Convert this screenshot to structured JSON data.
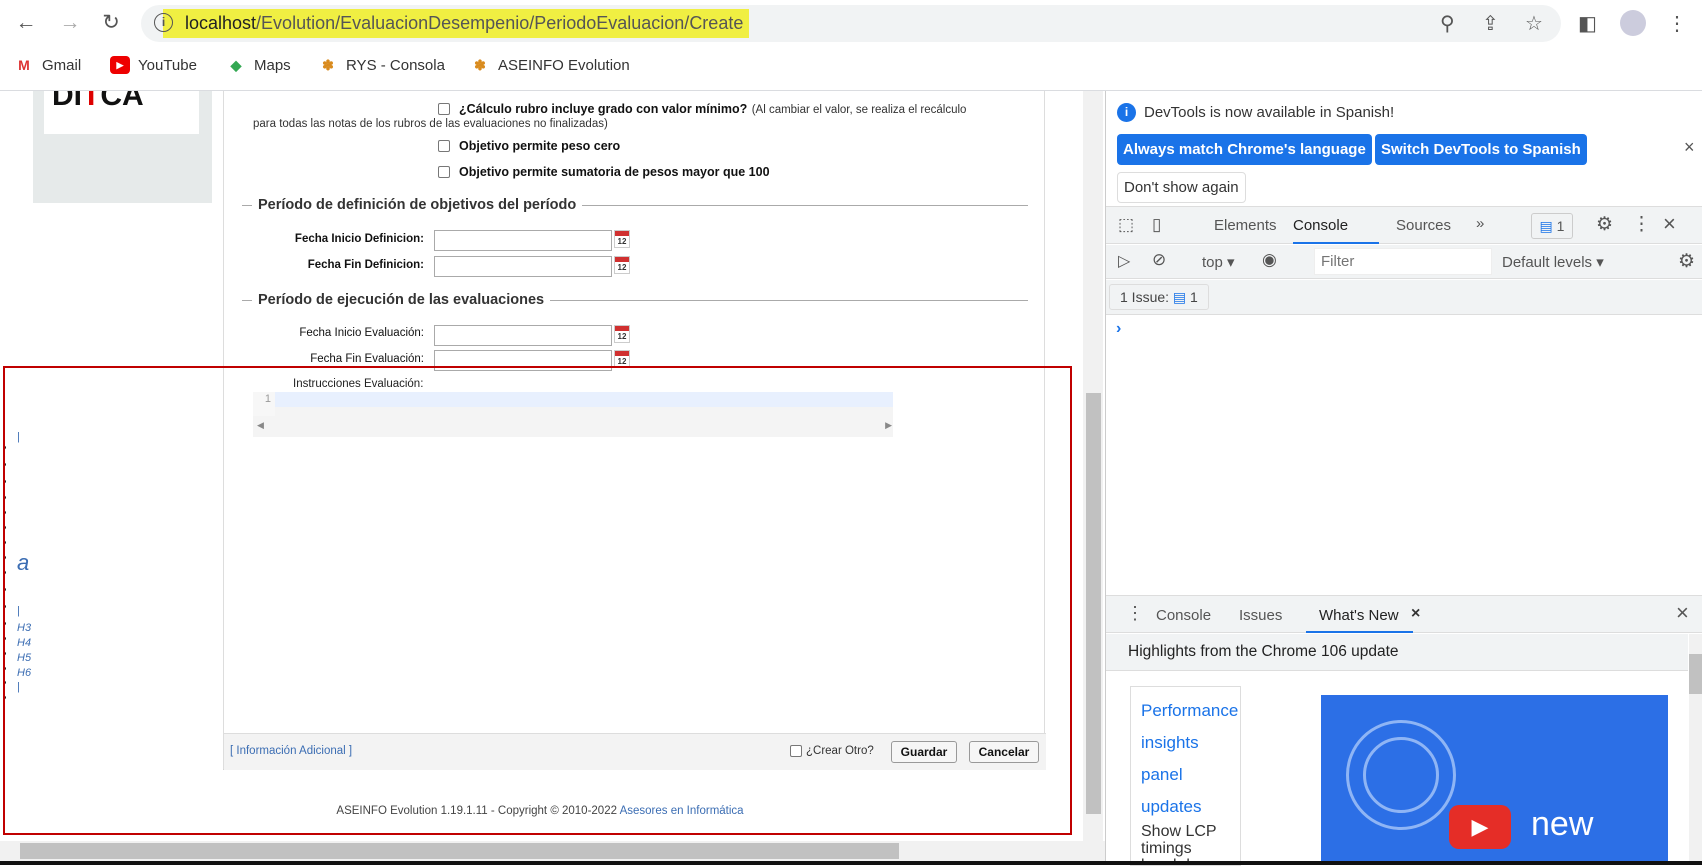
{
  "browser": {
    "url_host": "localhost",
    "url_path": "/Evolution/EvaluacionDesempenio/PeriodoEvaluacion/Create",
    "bookmarks": [
      {
        "label": "Gmail",
        "icon": "gmail-icon"
      },
      {
        "label": "YouTube",
        "icon": "youtube-icon"
      },
      {
        "label": "Maps",
        "icon": "maps-icon"
      },
      {
        "label": "RYS - Consola",
        "icon": "aseinfo-icon"
      },
      {
        "label": "ASEINFO Evolution",
        "icon": "aseinfo-icon"
      }
    ]
  },
  "logo": {
    "text": "DITCA"
  },
  "form": {
    "checks": [
      {
        "label": "¿Cálculo rubro incluye grado con valor mínimo?",
        "note": "(Al cambiar el valor, se realiza el recálculo",
        "note2": "para todas las notas de los rubros de las evaluaciones no finalizadas)"
      },
      {
        "label": "Objetivo permite peso cero"
      },
      {
        "label": "Objetivo permite sumatoria de pesos mayor que 100"
      }
    ],
    "section1": "Período de definición de objetivos del período",
    "fecha_inicio_def": "Fecha Inicio Definicion:",
    "fecha_fin_def": "Fecha Fin Definicion:",
    "section2": "Período de ejecución de las evaluaciones",
    "fecha_inicio_eval": "Fecha Inicio Evaluación:",
    "fecha_fin_eval": "Fecha Fin Evaluación:",
    "instrucciones": "Instrucciones Evaluación:",
    "line_number": "1",
    "calendar_day": "12",
    "info_adicional": "[ Información Adicional ]",
    "crear_otro": "¿Crear Otro?",
    "guardar": "Guardar",
    "cancelar": "Cancelar"
  },
  "stray": {
    "a": "a",
    "pipe": "|",
    "h3": "H3",
    "h4": "H4",
    "h5": "H5",
    "h6": "H6"
  },
  "footer": {
    "text": "ASEINFO Evolution 1.19.1.11 - Copyright © 2010-2022 ",
    "link": "Asesores en Informática"
  },
  "devtools": {
    "infobar": "DevTools is now available in Spanish!",
    "btn_match": "Always match Chrome's language",
    "btn_switch": "Switch DevTools to Spanish",
    "btn_dont": "Don't show again",
    "tabs": [
      "Elements",
      "Console",
      "Sources"
    ],
    "active_tab": "Console",
    "issues_badge": "1",
    "context": "top",
    "filter_placeholder": "Filter",
    "levels": "Default levels",
    "issues_row": "1 Issue:",
    "issues_count": "1",
    "prompt": "›",
    "drawer_tabs": [
      "Console",
      "Issues",
      "What's New"
    ],
    "highlights": "Highlights from the Chrome 106 update",
    "toc": [
      "Performance",
      "insights",
      "panel",
      "updates"
    ],
    "toc_text": [
      "Show LCP",
      "timings",
      "breakdown"
    ],
    "video_text": "new",
    "accent": "#1a73e8"
  }
}
